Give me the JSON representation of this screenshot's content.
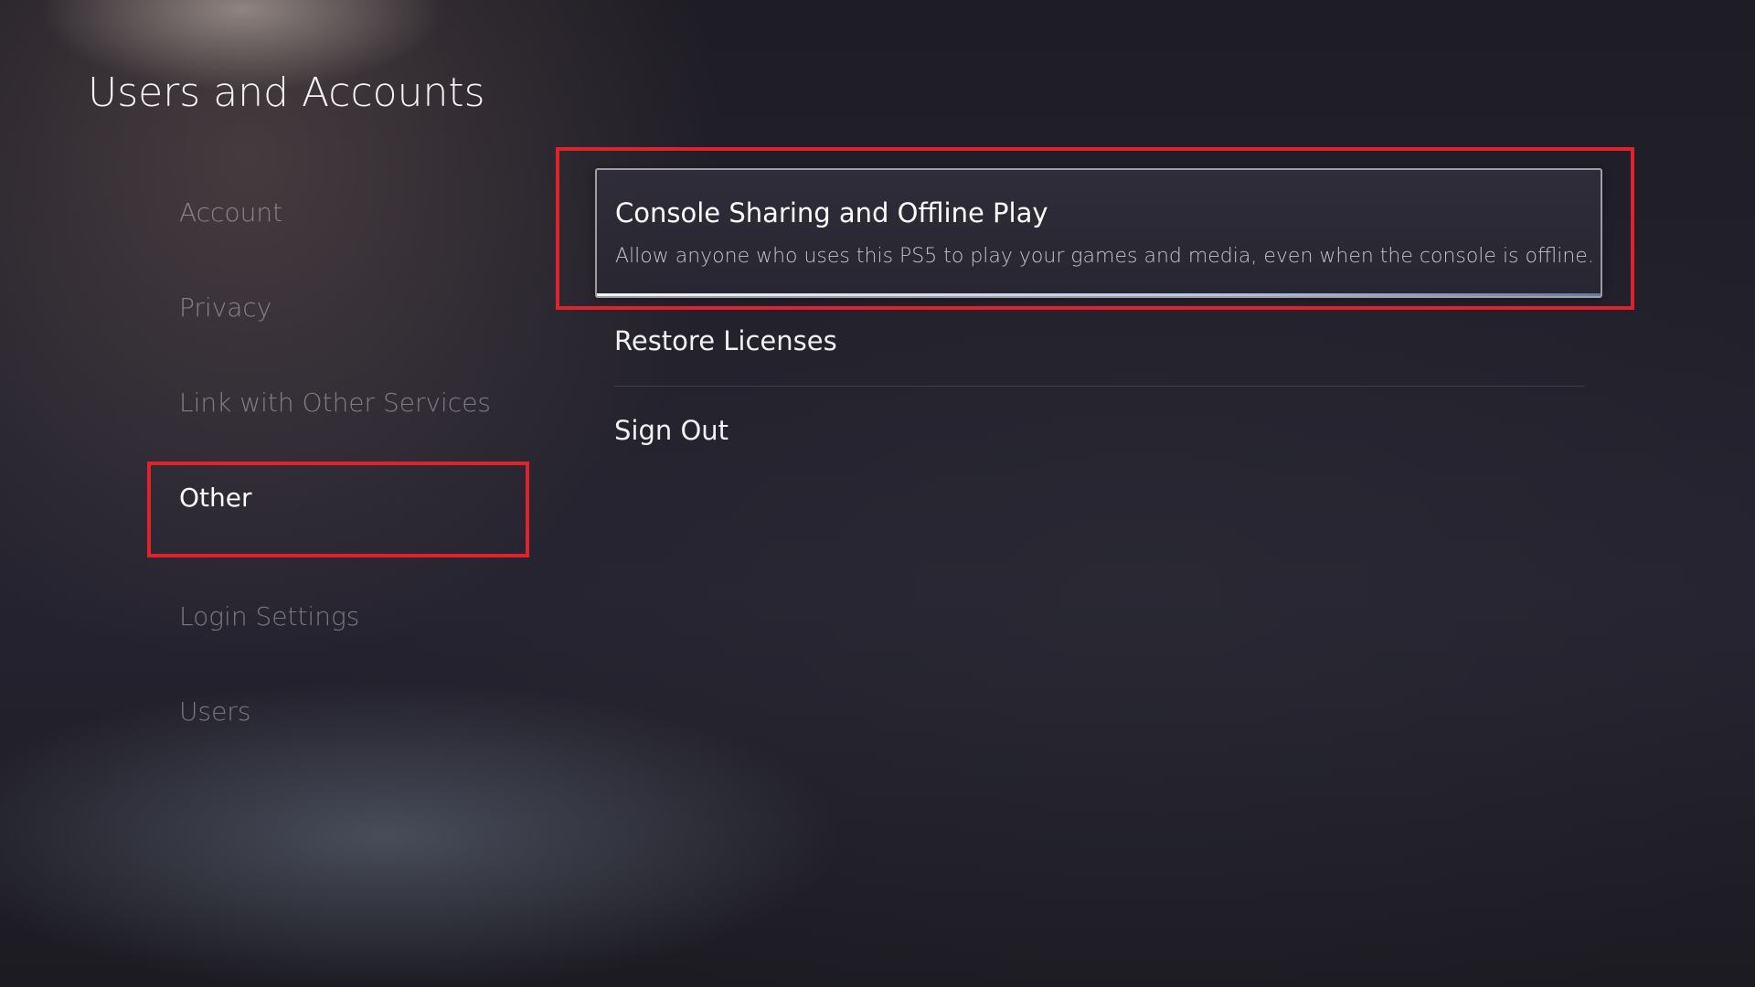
{
  "header": {
    "title": "Users and Accounts"
  },
  "sidebar": {
    "items": [
      {
        "label": "Account",
        "active": false
      },
      {
        "label": "Privacy",
        "active": false
      },
      {
        "label": "Link with Other Services",
        "active": false
      },
      {
        "label": "Other",
        "active": true
      },
      {
        "label": "Login Settings",
        "active": false
      },
      {
        "label": "Users",
        "active": false
      }
    ]
  },
  "main": {
    "items": [
      {
        "title": "Console Sharing and Offline Play",
        "description": "Allow anyone who uses this PS5 to play your games and media, even when the console is offline."
      },
      {
        "title": "Restore Licenses"
      },
      {
        "title": "Sign Out"
      }
    ]
  },
  "colors": {
    "highlight": "#e0222c",
    "background": "#1f1d26"
  }
}
